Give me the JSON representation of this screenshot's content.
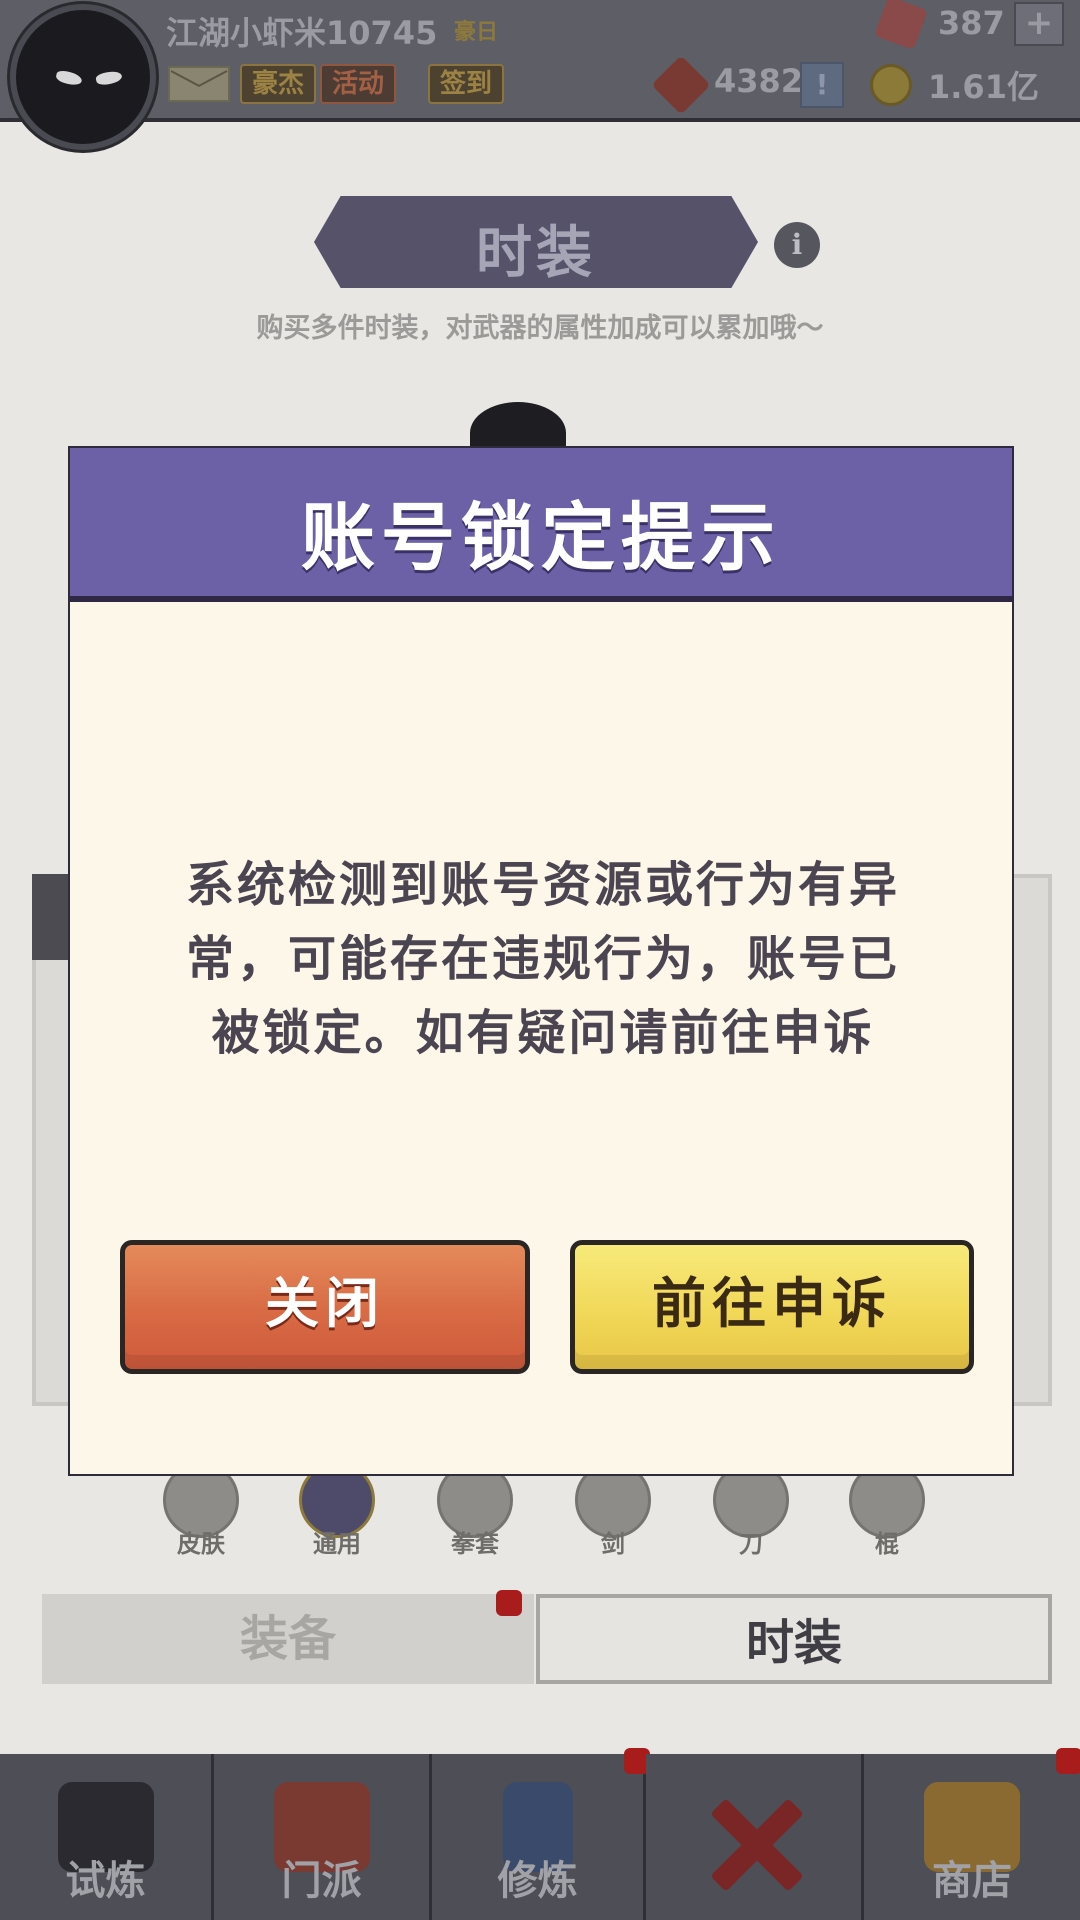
{
  "status_bar": {
    "username": "江湖小虾米10745",
    "vip_tag": "豪日",
    "tags": [
      "豪杰",
      "活动",
      "签到"
    ],
    "gem_count": "387",
    "token_count": "4382",
    "gold_count": "1.61亿",
    "plus": "+",
    "alert": "!"
  },
  "page": {
    "title": "时装",
    "info": "i",
    "subtitle": "购买多件时装，对武器的属性加成可以累加哦～",
    "categories": [
      "皮肤",
      "通用",
      "拳套",
      "剑",
      "刀",
      "棍"
    ],
    "tabs": [
      "装备",
      "时装"
    ]
  },
  "bottom_nav": {
    "items": [
      "试炼",
      "门派",
      "修炼",
      "",
      "商店"
    ]
  },
  "modal": {
    "title": "账号锁定提示",
    "message_lines": [
      "系统检测到账号资源或行为有异",
      "常，可能存在违规行为，账号已",
      "被锁定。如有疑问请前往申诉"
    ],
    "close_button": "关闭",
    "appeal_button": "前往申诉"
  },
  "colors": {
    "modal_header": "#6c61a6",
    "modal_body": "#fdf7ea",
    "close_button": "#d86a44",
    "appeal_button": "#f1d858"
  }
}
